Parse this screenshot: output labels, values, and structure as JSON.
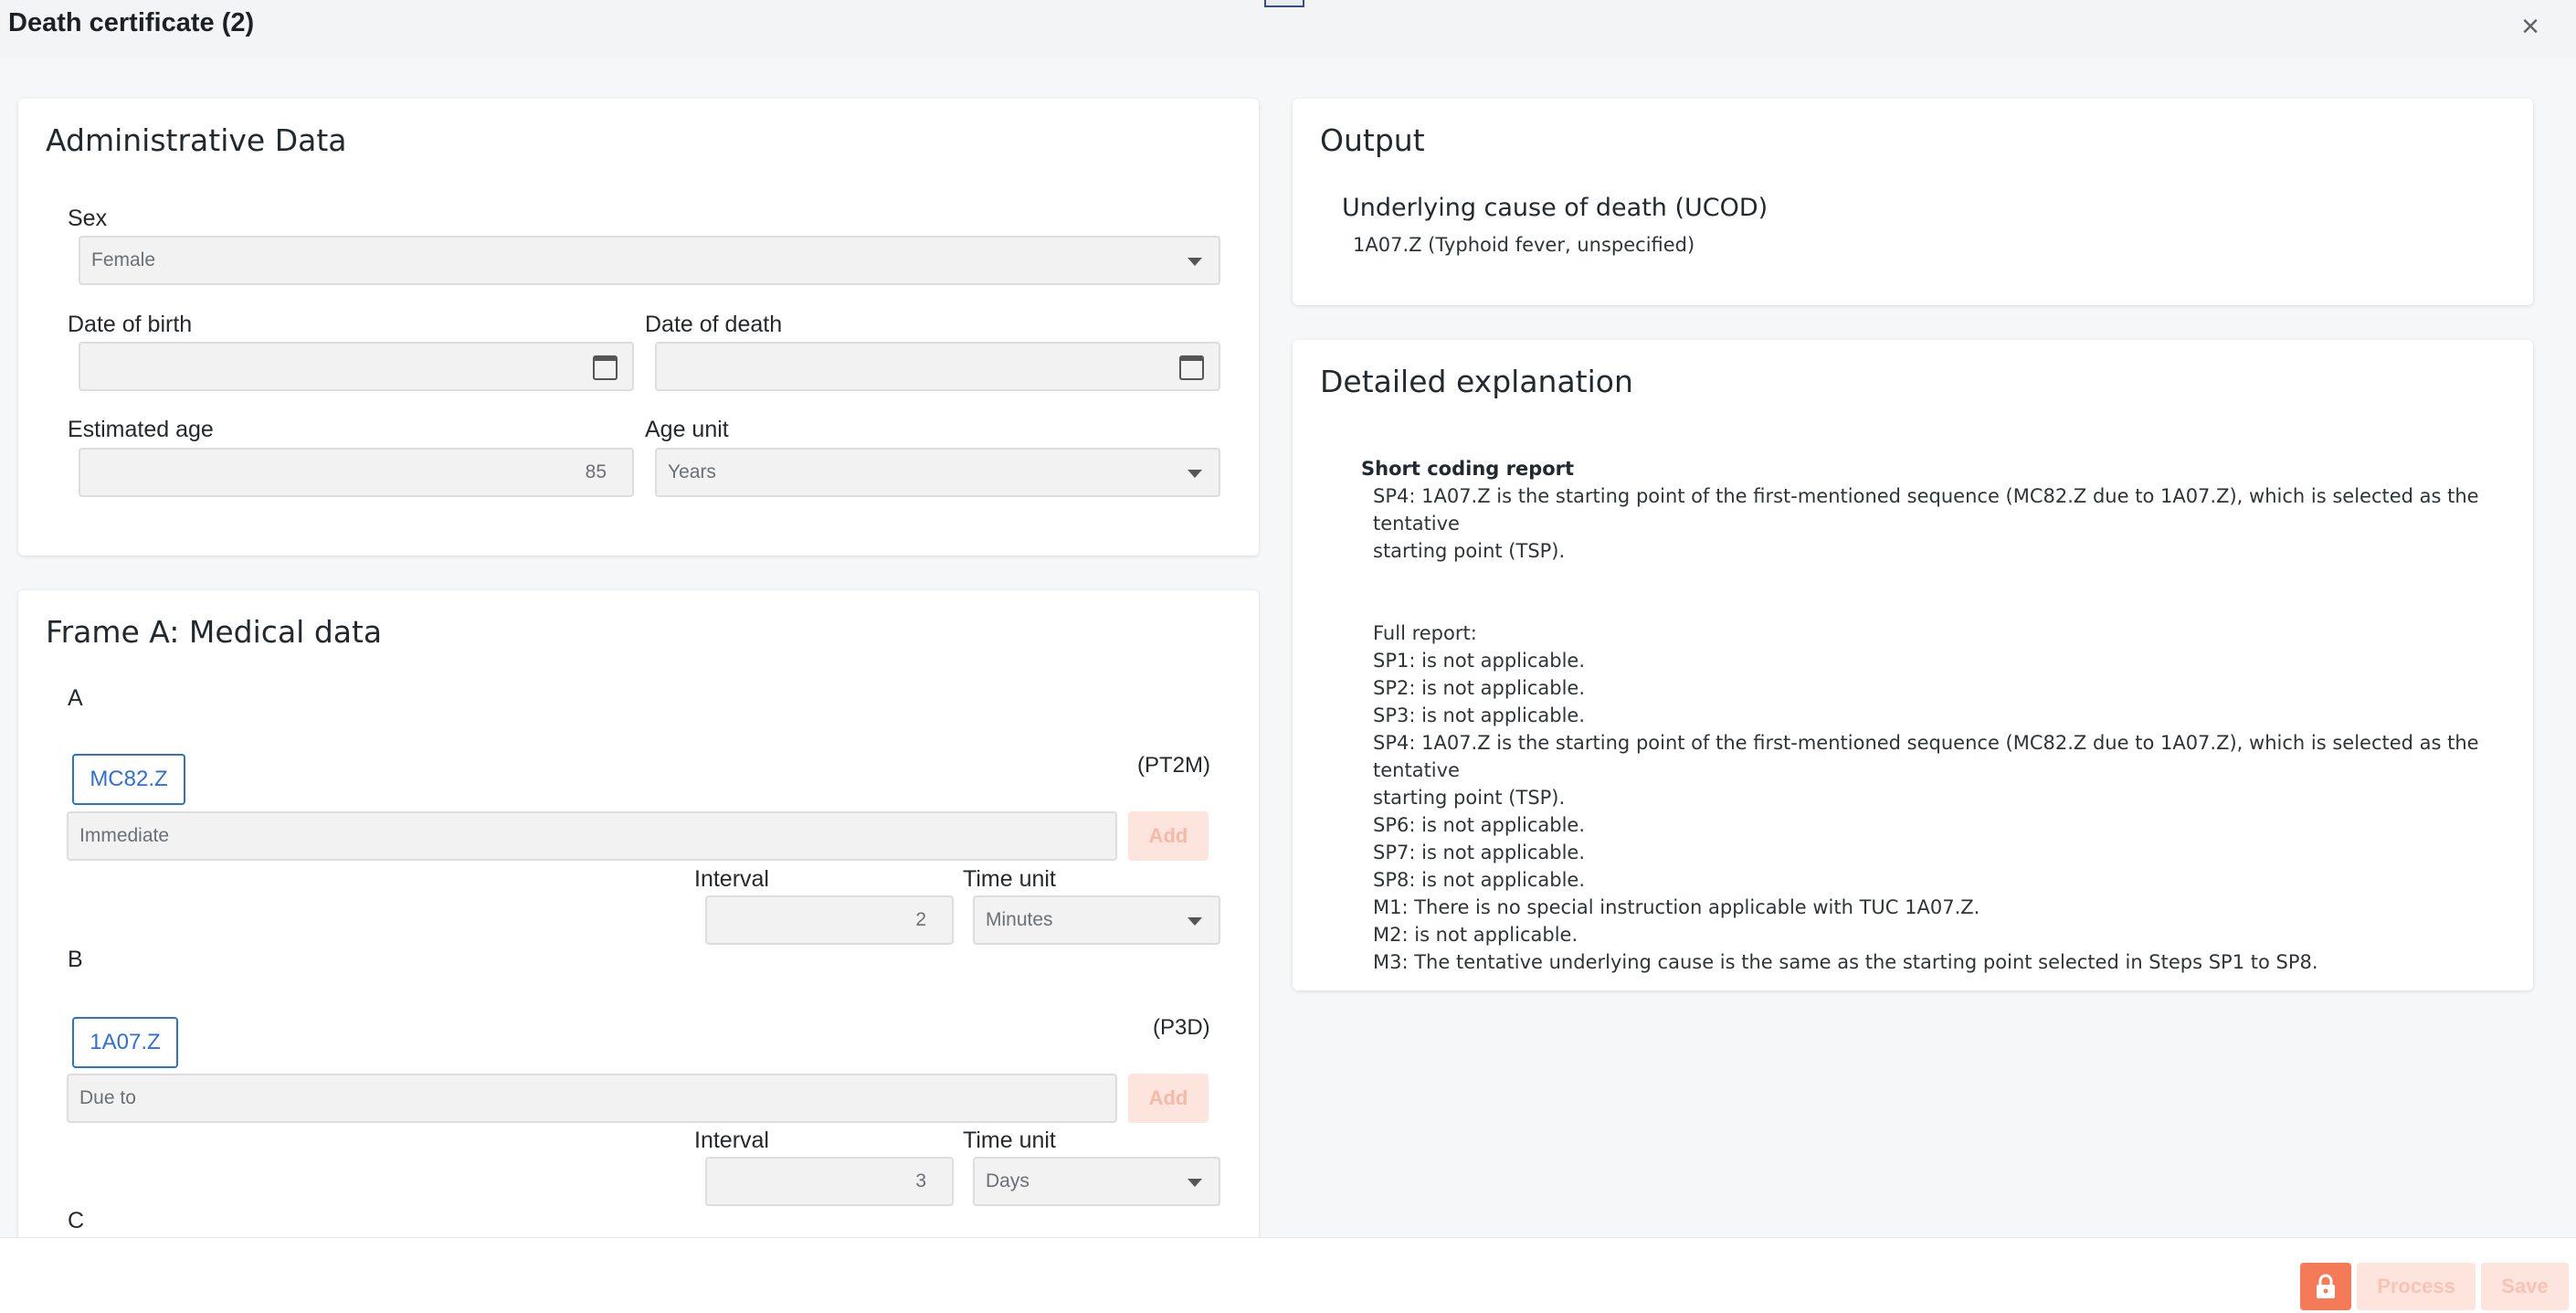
{
  "window": {
    "title": "Death certificate (2)",
    "close_icon": "×"
  },
  "admin": {
    "heading": "Administrative Data",
    "sex_label": "Sex",
    "sex_value": "Female",
    "dob_label": "Date of birth",
    "dob_value": "",
    "dod_label": "Date of death",
    "dod_value": "",
    "age_label": "Estimated age",
    "age_value": "85",
    "age_unit_label": "Age unit",
    "age_unit_value": "Years"
  },
  "frame_a": {
    "heading": "Frame A: Medical data",
    "add_label": "Add",
    "interval_label": "Interval",
    "time_unit_label": "Time unit",
    "line_a": {
      "letter": "A",
      "code": "MC82.Z",
      "duration": "(PT2M)",
      "placeholder": "Immediate",
      "interval": "2",
      "unit": "Minutes"
    },
    "line_b": {
      "letter": "B",
      "code": "1A07.Z",
      "duration": "(P3D)",
      "placeholder": "Due to",
      "interval": "3",
      "unit": "Days"
    },
    "line_c": {
      "letter": "C"
    }
  },
  "output": {
    "heading": "Output",
    "ucod_title": "Underlying cause of death (UCOD)",
    "ucod_value": "1A07.Z (Typhoid fever, unspecified)"
  },
  "explanation": {
    "heading": "Detailed explanation",
    "short_title": "Short coding report",
    "short_lines": [
      "SP4: 1A07.Z is the starting point of the first-mentioned sequence (MC82.Z due to 1A07.Z), which is selected as the tentative",
      "starting point (TSP)."
    ],
    "full_lines": [
      "Full report:",
      "SP1: is not applicable.",
      "SP2: is not applicable.",
      "SP3: is not applicable.",
      "SP4: 1A07.Z is the starting point of the first-mentioned sequence (MC82.Z due to 1A07.Z), which is selected as the tentative",
      "starting point (TSP).",
      "SP6: is not applicable.",
      "SP7: is not applicable.",
      "SP8: is not applicable.",
      "M1: There is no special instruction applicable with TUC 1A07.Z.",
      "M2: is not applicable.",
      "M3: The tentative underlying cause is the same as the starting point selected in Steps SP1 to SP8."
    ]
  },
  "footer": {
    "process_label": "Process",
    "save_label": "Save",
    "lock_icon": "lock-icon"
  },
  "colors": {
    "accent": "#2f6fd6",
    "primary_action": "#f47a58",
    "disabled_action": "#fde4dc"
  }
}
